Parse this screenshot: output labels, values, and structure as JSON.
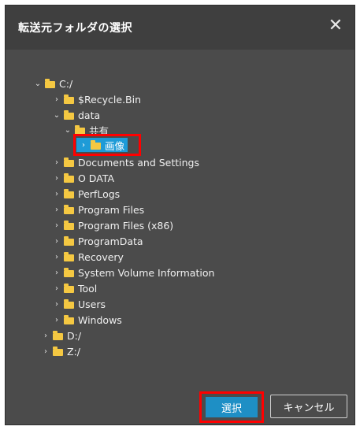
{
  "dialog": {
    "title": "転送元フォルダの選択",
    "close_glyph": "✕"
  },
  "tree": {
    "nodes": [
      {
        "label": "C:/",
        "expanded": true
      },
      {
        "label": "$Recycle.Bin",
        "expanded": false
      },
      {
        "label": "data",
        "expanded": true
      },
      {
        "label": "共有",
        "expanded": true
      },
      {
        "label": "画像",
        "expanded": false,
        "selected": true
      },
      {
        "label": "Documents and Settings",
        "expanded": false
      },
      {
        "label": "O DATA",
        "expanded": false
      },
      {
        "label": "PerfLogs",
        "expanded": false
      },
      {
        "label": "Program Files",
        "expanded": false
      },
      {
        "label": "Program Files (x86)",
        "expanded": false
      },
      {
        "label": "ProgramData",
        "expanded": false
      },
      {
        "label": "Recovery",
        "expanded": false
      },
      {
        "label": "System Volume Information",
        "expanded": false
      },
      {
        "label": "Tool",
        "expanded": false
      },
      {
        "label": "Users",
        "expanded": false
      },
      {
        "label": "Windows",
        "expanded": false
      },
      {
        "label": "D:/",
        "expanded": false
      },
      {
        "label": "Z:/",
        "expanded": false
      }
    ]
  },
  "buttons": {
    "select_label": "選択",
    "cancel_label": "キャンセル"
  },
  "colors": {
    "dialog_bg": "#4b4b4b",
    "selection": "#1e9bd7",
    "highlight_box": "#ff0000",
    "folder": "#f5c842"
  }
}
